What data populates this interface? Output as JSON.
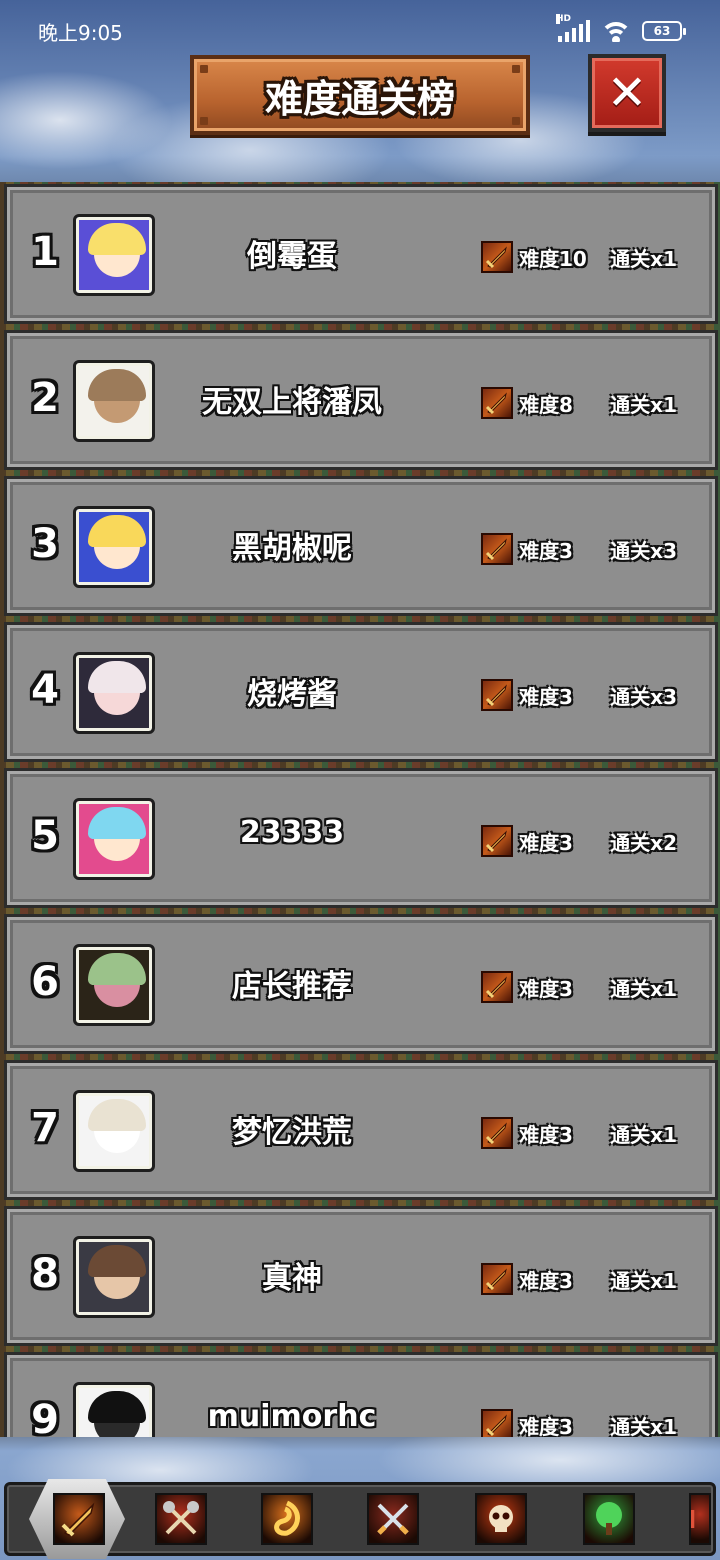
{
  "status_bar": {
    "time": "晚上9:05",
    "network": "HD",
    "battery": "63"
  },
  "header": {
    "title": "难度通关榜",
    "close_icon": "close-x-icon"
  },
  "rows": [
    {
      "rank": "1",
      "name": "倒霉蛋",
      "difficulty": "难度10",
      "clears": "通关x1",
      "avatar_colors": [
        "#5a4fd6",
        "#f9df6b",
        "#ffe7cf"
      ]
    },
    {
      "rank": "2",
      "name": "无双上将潘凤",
      "difficulty": "难度8",
      "clears": "通关x1",
      "avatar_colors": [
        "#f3f2ec",
        "#9c7b5a",
        "#c49a73"
      ]
    },
    {
      "rank": "3",
      "name": "黑胡椒呢",
      "difficulty": "难度3",
      "clears": "通关x3",
      "avatar_colors": [
        "#3a4fd0",
        "#f9d85a",
        "#ffe7cf"
      ]
    },
    {
      "rank": "4",
      "name": "烧烤酱",
      "difficulty": "难度3",
      "clears": "通关x3",
      "avatar_colors": [
        "#2e2a3a",
        "#f0e6ea",
        "#f6d8d8"
      ]
    },
    {
      "rank": "5",
      "name": "23333",
      "difficulty": "难度3",
      "clears": "通关x2",
      "avatar_colors": [
        "#e34b8e",
        "#7fd7f0",
        "#ffe7cf"
      ]
    },
    {
      "rank": "6",
      "name": "店长推荐",
      "difficulty": "难度3",
      "clears": "通关x1",
      "avatar_colors": [
        "#2b2418",
        "#9bc28a",
        "#d98fa1"
      ]
    },
    {
      "rank": "7",
      "name": "梦忆洪荒",
      "difficulty": "难度3",
      "clears": "通关x1",
      "avatar_colors": [
        "#f4f4f4",
        "#e9e2d2",
        "#ffffff"
      ]
    },
    {
      "rank": "8",
      "name": "真神",
      "difficulty": "难度3",
      "clears": "通关x1",
      "avatar_colors": [
        "#3a3a44",
        "#6b4a35",
        "#e6c6a8"
      ]
    },
    {
      "rank": "9",
      "name": "muimorhc",
      "difficulty": "难度3",
      "clears": "通关x1",
      "avatar_colors": [
        "#f4f4f4",
        "#111111",
        "#2a2a2a"
      ]
    }
  ],
  "tabs": [
    {
      "icon": "sword-icon",
      "label": "difficulty-tab",
      "selected": true,
      "color": "#c45a1a"
    },
    {
      "icon": "crossed-axes-icon",
      "label": "axes-tab",
      "selected": false,
      "color": "#b2301e"
    },
    {
      "icon": "fire-swirl-icon",
      "label": "fire-tab",
      "selected": false,
      "color": "#d9701c"
    },
    {
      "icon": "crossed-swords-icon",
      "label": "swords-tab",
      "selected": false,
      "color": "#8a2a1e"
    },
    {
      "icon": "skull-icon",
      "label": "skull-tab",
      "selected": false,
      "color": "#c23a12"
    },
    {
      "icon": "tree-icon",
      "label": "tree-tab",
      "selected": false,
      "color": "#2f9a3a"
    },
    {
      "icon": "partial-tab-icon",
      "label": "more-tab",
      "selected": false,
      "color": "#b2301e"
    }
  ]
}
